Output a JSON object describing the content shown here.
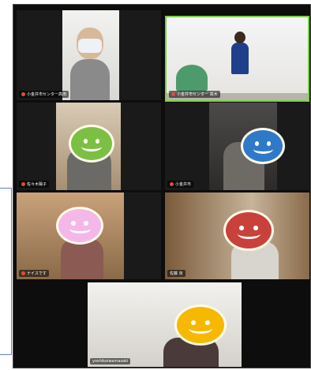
{
  "participants": [
    {
      "name": "小金井市センター高田",
      "smiley_color": "",
      "active": false
    },
    {
      "name": "小金井市センター 高木",
      "smiley_color": "",
      "active": true
    },
    {
      "name": "佐々木陽子",
      "smiley_color": "#7cc043",
      "active": false
    },
    {
      "name": "小金井市",
      "smiley_color": "#2f79c9",
      "active": false
    },
    {
      "name": "ナイスです",
      "smiley_color": "#f3b8e8",
      "active": false
    },
    {
      "name": "佐藤 京",
      "smiley_color": "#c8423b",
      "active": false
    },
    {
      "name": "yoshikoiwamazaki",
      "smiley_color": "#f6b800",
      "active": false
    }
  ]
}
